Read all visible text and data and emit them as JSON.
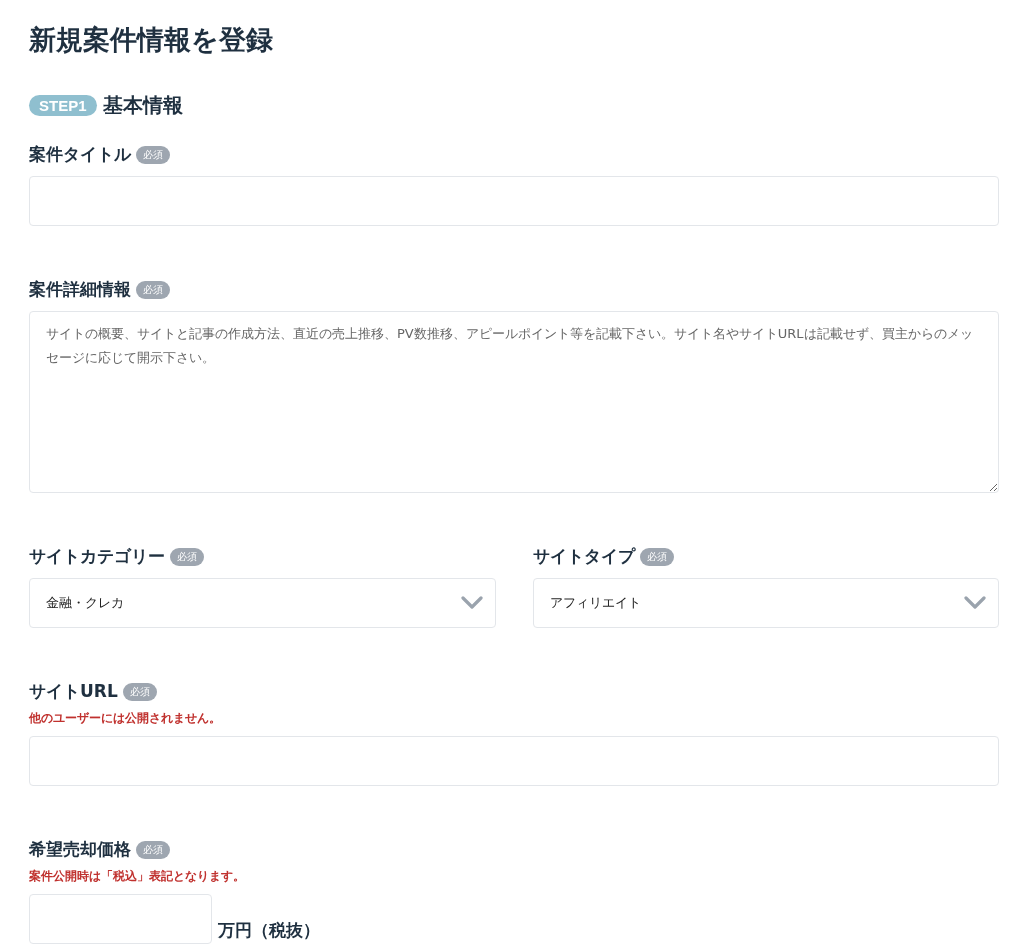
{
  "page_title": "新規案件情報を登録",
  "step": {
    "badge": "STEP1",
    "title": "基本情報"
  },
  "rows": [
    {
      "fields": [
        {
          "kind": "text",
          "label": "案件タイトル",
          "badge": "必須"
        }
      ]
    },
    {
      "fields": [
        {
          "kind": "textarea",
          "label": "案件詳細情報",
          "badge": "必須",
          "placeholder": "サイトの概要、サイトと記事の作成方法、直近の売上推移、PV数推移、アピールポイント等を記載下さい。サイト名やサイトURLは記載せず、買主からのメッセージに応じて開示下さい。"
        }
      ]
    },
    {
      "fields": [
        {
          "kind": "select",
          "label": "サイトカテゴリー",
          "badge": "必須",
          "value": "金融・クレカ"
        },
        {
          "kind": "select",
          "label": "サイトタイプ",
          "badge": "必須",
          "value": "アフィリエイト"
        }
      ]
    },
    {
      "fields": [
        {
          "kind": "text",
          "label": "サイトURL",
          "badge": "必須",
          "note": "他のユーザーには公開されません。"
        }
      ]
    },
    {
      "fields": [
        {
          "kind": "price",
          "label": "希望売却価格",
          "badge": "必須",
          "note": "案件公開時は「税込」表記となります。",
          "unit": "万円（税抜）"
        }
      ]
    }
  ]
}
